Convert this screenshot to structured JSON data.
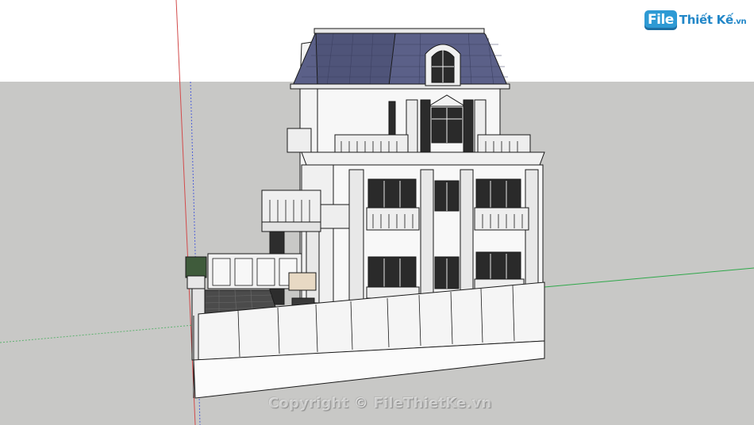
{
  "logo": {
    "badge": "File",
    "name": "Thiết Kế",
    "suffix": ".vn"
  },
  "watermark": {
    "text": "Copyright © FileThietKe.vn"
  },
  "colors": {
    "sky": "#ffffff",
    "ground": "#c8c8c6",
    "red_axis": "#d24b4b",
    "green_axis": "#2fa84a",
    "blue_axis": "#4d5fd8",
    "roof": "#5b6088",
    "logo_blue": "#2e9ad4"
  }
}
